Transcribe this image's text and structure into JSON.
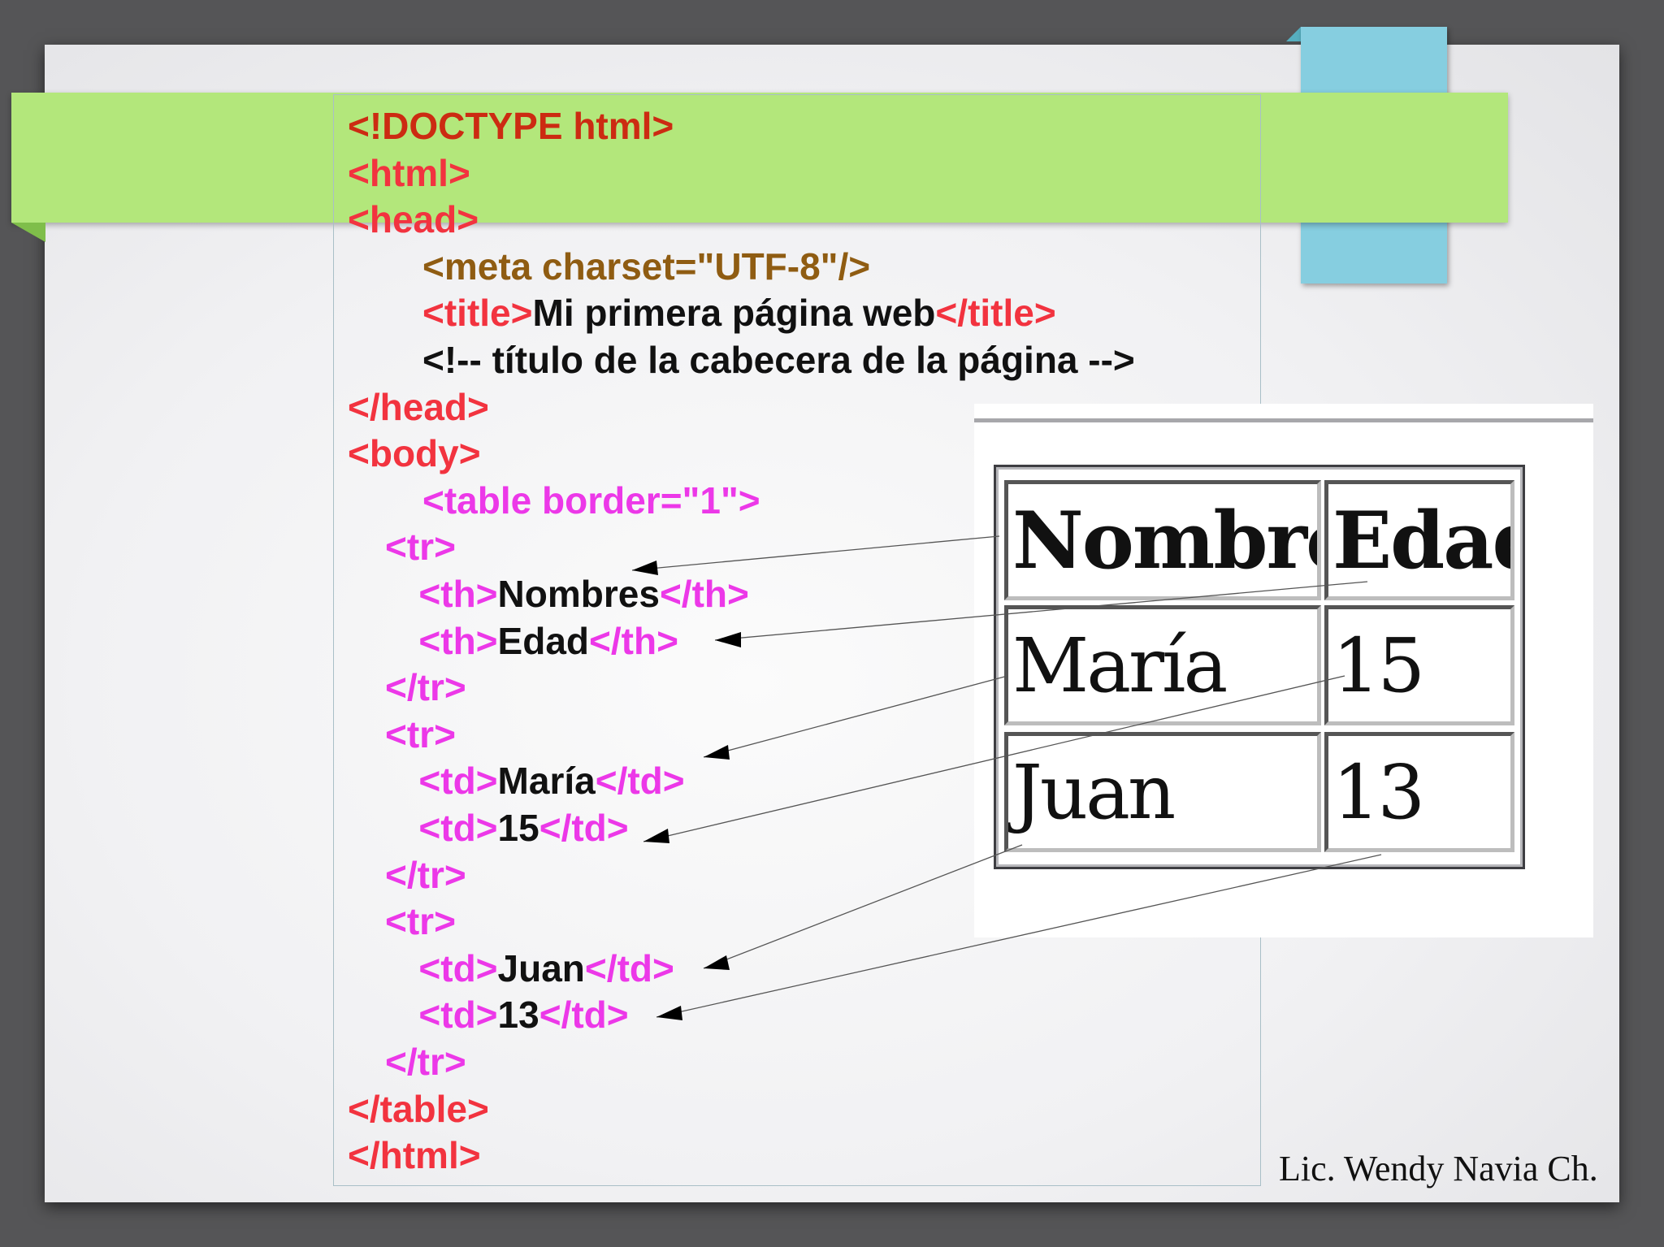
{
  "code_lines": [
    {
      "indent": 0,
      "parts": [
        {
          "t": "<!DOCTYPE html>",
          "c": "darkred"
        }
      ]
    },
    {
      "indent": 0,
      "parts": [
        {
          "t": "<html>",
          "c": "red"
        }
      ]
    },
    {
      "indent": 0,
      "parts": [
        {
          "t": "<head>",
          "c": "red"
        }
      ]
    },
    {
      "indent": 2,
      "parts": [
        {
          "t": "<meta charset=\"UTF-8\"/>",
          "c": "olive"
        }
      ]
    },
    {
      "indent": 2,
      "parts": [
        {
          "t": "<title>",
          "c": "red"
        },
        {
          "t": "Mi primera página web",
          "c": "blk"
        },
        {
          "t": "</title>",
          "c": "red"
        }
      ]
    },
    {
      "indent": 2,
      "parts": [
        {
          "t": "<!-- título de la cabecera de la página -->",
          "c": "blk"
        }
      ]
    },
    {
      "indent": 0,
      "parts": [
        {
          "t": "</head>",
          "c": "red"
        }
      ]
    },
    {
      "indent": 0,
      "parts": [
        {
          "t": "<body>",
          "c": "red"
        }
      ]
    },
    {
      "indent": 2,
      "parts": [
        {
          "t": "<table border=\"1\">",
          "c": "mag"
        }
      ]
    },
    {
      "indent": 1,
      "parts": [
        {
          "t": "<tr>",
          "c": "mag"
        }
      ]
    },
    {
      "indent": 1.9,
      "parts": [
        {
          "t": "<th>",
          "c": "mag"
        },
        {
          "t": "Nombres",
          "c": "blk"
        },
        {
          "t": "</th>",
          "c": "mag"
        }
      ]
    },
    {
      "indent": 1.9,
      "parts": [
        {
          "t": "<th>",
          "c": "mag"
        },
        {
          "t": "Edad",
          "c": "blk"
        },
        {
          "t": "</th>",
          "c": "mag"
        }
      ]
    },
    {
      "indent": 1,
      "parts": [
        {
          "t": "</tr>",
          "c": "mag"
        }
      ]
    },
    {
      "indent": 1,
      "parts": [
        {
          "t": "<tr>",
          "c": "mag"
        }
      ]
    },
    {
      "indent": 1.9,
      "parts": [
        {
          "t": "<td>",
          "c": "mag"
        },
        {
          "t": "María",
          "c": "blk"
        },
        {
          "t": "</td>",
          "c": "mag"
        }
      ]
    },
    {
      "indent": 1.9,
      "parts": [
        {
          "t": "<td>",
          "c": "mag"
        },
        {
          "t": "15",
          "c": "blk"
        },
        {
          "t": "</td>",
          "c": "mag"
        }
      ]
    },
    {
      "indent": 1,
      "parts": [
        {
          "t": "</tr>",
          "c": "mag"
        }
      ]
    },
    {
      "indent": 1,
      "parts": [
        {
          "t": "<tr>",
          "c": "mag"
        }
      ]
    },
    {
      "indent": 1.9,
      "parts": [
        {
          "t": "<td>",
          "c": "mag"
        },
        {
          "t": "Juan",
          "c": "blk"
        },
        {
          "t": "</td>",
          "c": "mag"
        }
      ]
    },
    {
      "indent": 1.9,
      "parts": [
        {
          "t": "<td>",
          "c": "mag"
        },
        {
          "t": "13",
          "c": "blk"
        },
        {
          "t": "</td>",
          "c": "mag"
        }
      ]
    },
    {
      "indent": 1,
      "parts": [
        {
          "t": "</tr>",
          "c": "mag"
        }
      ]
    },
    {
      "indent": 0,
      "parts": [
        {
          "t": "</table>",
          "c": "red"
        }
      ]
    },
    {
      "indent": 0,
      "parts": [
        {
          "t": "</html>",
          "c": "red"
        }
      ]
    }
  ],
  "rendered_table": {
    "headers": [
      "Nombres",
      "Edad"
    ],
    "rows": [
      [
        "María",
        "15"
      ],
      [
        "Juan",
        "13"
      ]
    ]
  },
  "author": "Lic. Wendy Navia Ch."
}
